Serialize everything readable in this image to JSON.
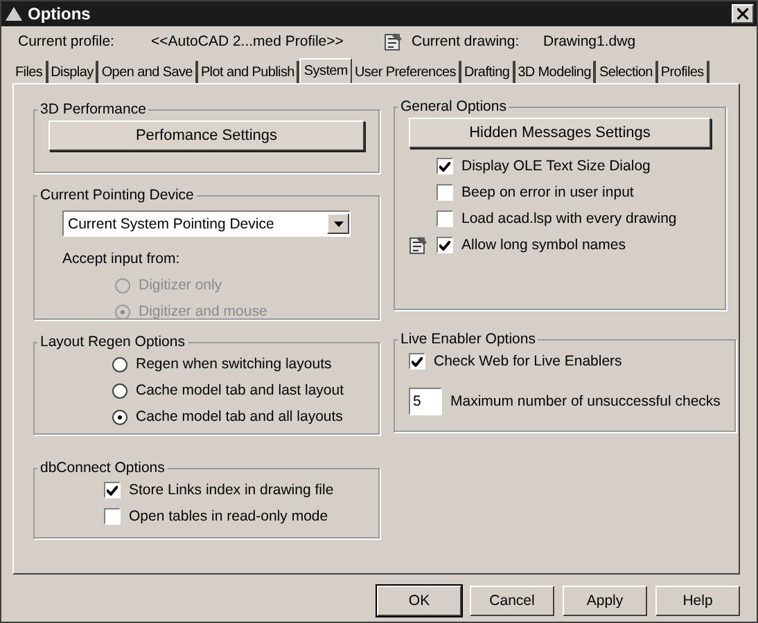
{
  "window": {
    "title": "Options"
  },
  "profile": {
    "label": "Current profile:",
    "value": "<<AutoCAD 2...med Profile>>",
    "drawing_label": "Current drawing:",
    "drawing_value": "Drawing1.dwg"
  },
  "tabs": [
    {
      "label": "Files",
      "selected": false
    },
    {
      "label": "Display",
      "selected": false
    },
    {
      "label": "Open and Save",
      "selected": false
    },
    {
      "label": "Plot and Publish",
      "selected": false
    },
    {
      "label": "System",
      "selected": true
    },
    {
      "label": "User Preferences",
      "selected": false
    },
    {
      "label": "Drafting",
      "selected": false
    },
    {
      "label": "3D Modeling",
      "selected": false
    },
    {
      "label": "Selection",
      "selected": false
    },
    {
      "label": "Profiles",
      "selected": false
    }
  ],
  "left_groups": [
    {
      "title": "3D Performance",
      "items": [
        {
          "kind": "button",
          "label": "Perfomance Settings"
        }
      ]
    },
    {
      "title": "Current Pointing Device",
      "items": [
        {
          "kind": "dropdown",
          "value": "Current System Pointing Device"
        },
        {
          "kind": "label",
          "text": "Accept input from:"
        },
        {
          "kind": "radio",
          "label": "Digitizer only",
          "selected": false,
          "disabled": true
        },
        {
          "kind": "radio",
          "label": "Digitizer and mouse",
          "selected": true,
          "disabled": true
        }
      ]
    },
    {
      "title": "Layout Regen Options",
      "items": [
        {
          "kind": "radio",
          "label": "Regen when switching layouts",
          "selected": false,
          "disabled": false
        },
        {
          "kind": "radio",
          "label": "Cache model tab and last layout",
          "selected": false,
          "disabled": false
        },
        {
          "kind": "radio",
          "label": "Cache model tab and all layouts",
          "selected": true,
          "disabled": false
        }
      ]
    },
    {
      "title": "dbConnect Options",
      "items": [
        {
          "kind": "checkbox",
          "label": "Store Links index in drawing file",
          "checked": true
        },
        {
          "kind": "checkbox",
          "label": "Open tables in read-only mode",
          "checked": false
        }
      ]
    }
  ],
  "right_groups": [
    {
      "title": "General Options",
      "items": [
        {
          "kind": "button",
          "label": "Hidden Messages Settings"
        },
        {
          "kind": "checkbox",
          "label": "Display OLE Text Size Dialog",
          "checked": true
        },
        {
          "kind": "checkbox",
          "label": "Beep on error in user input",
          "checked": false
        },
        {
          "kind": "checkbox",
          "label": "Load acad.lsp with every drawing",
          "checked": false
        },
        {
          "kind": "checkbox",
          "label": "Allow long symbol names",
          "checked": true,
          "icon": true
        }
      ]
    },
    {
      "title": "Live Enabler Options",
      "items": [
        {
          "kind": "checkbox",
          "label": "Check Web for Live Enablers",
          "checked": true
        },
        {
          "kind": "number",
          "value": "5",
          "label": "Maximum number of unsuccessful checks"
        }
      ]
    }
  ],
  "buttons": [
    {
      "label": "OK",
      "default": true
    },
    {
      "label": "Cancel",
      "default": false
    },
    {
      "label": "Apply",
      "default": false
    },
    {
      "label": "Help",
      "default": false
    }
  ]
}
